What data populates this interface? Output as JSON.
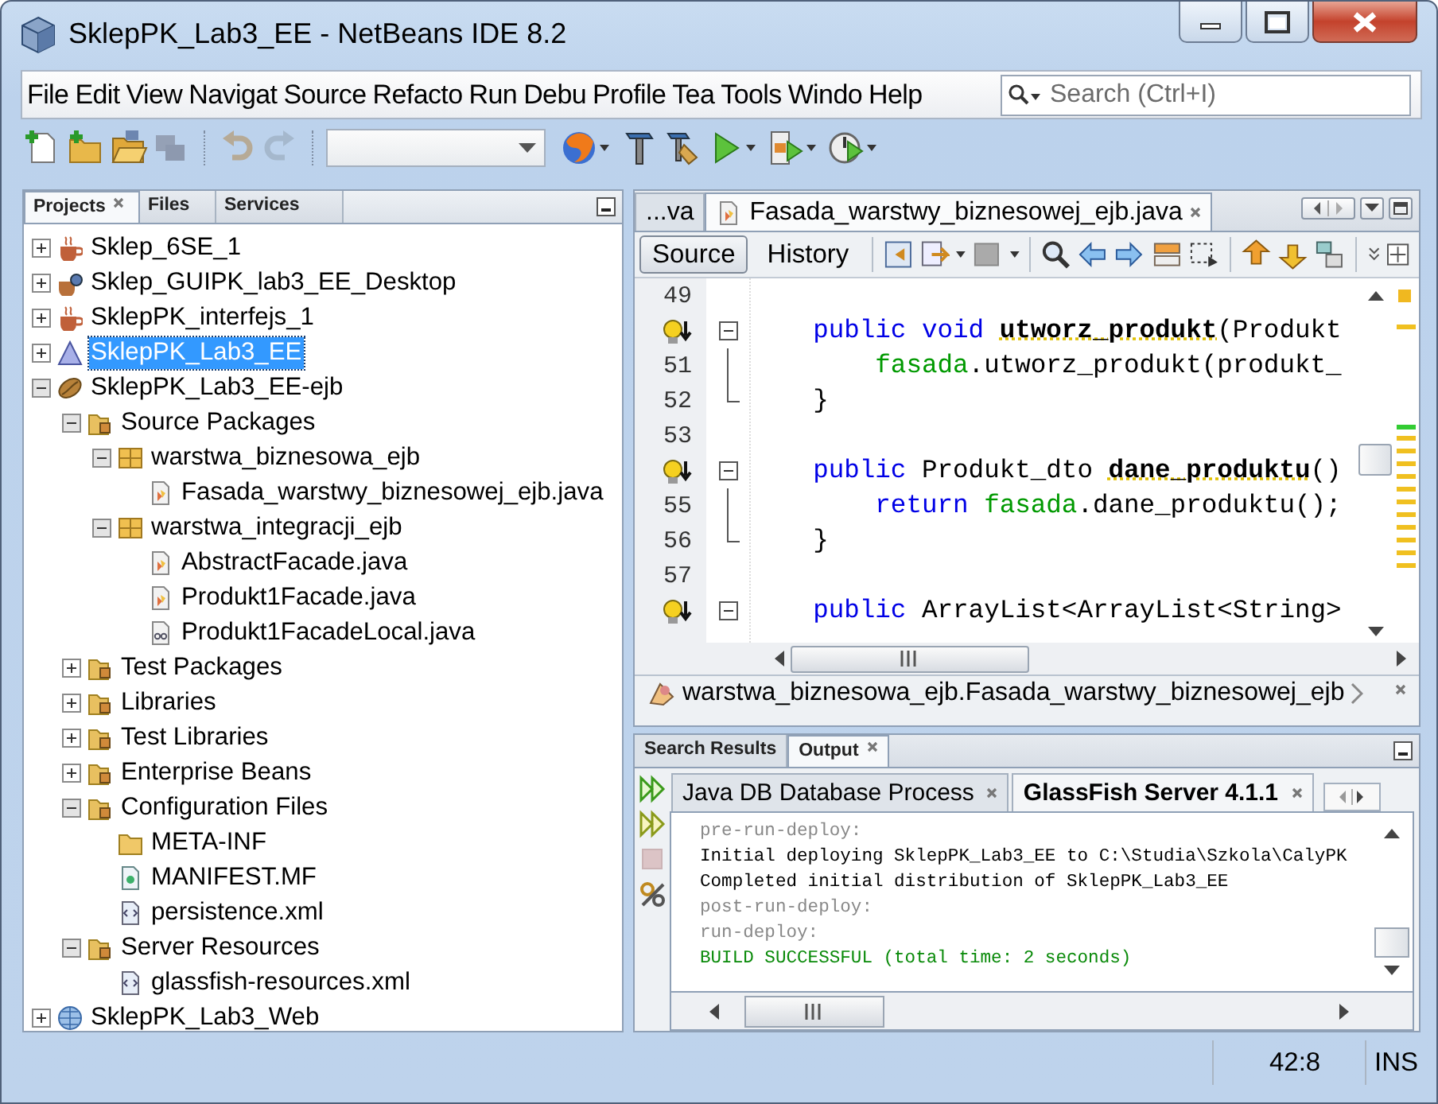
{
  "window": {
    "title": "SklepPK_Lab3_EE - NetBeans IDE 8.2"
  },
  "menu": [
    "File",
    "Edit",
    "View",
    "Navigat",
    "Source",
    "Refacto",
    "Run",
    "Debu",
    "Profile",
    "Tea",
    "Tools",
    "Windo",
    "Help"
  ],
  "search": {
    "placeholder": "Search (Ctrl+I)"
  },
  "toolbar": [
    {
      "kind": "new-file",
      "disabled": false
    },
    {
      "kind": "new-project",
      "disabled": false
    },
    {
      "kind": "open-project",
      "disabled": false
    },
    {
      "kind": "close-project",
      "disabled": true
    },
    {
      "kind": "separator"
    },
    {
      "kind": "undo",
      "disabled": true
    },
    {
      "kind": "redo",
      "disabled": true
    },
    {
      "kind": "separator"
    },
    {
      "kind": "combo"
    },
    {
      "kind": "browser",
      "disabled": false,
      "menu": true
    },
    {
      "kind": "build",
      "disabled": false
    },
    {
      "kind": "clean-build",
      "disabled": false
    },
    {
      "kind": "run",
      "disabled": false,
      "menu": true
    },
    {
      "kind": "debug",
      "disabled": false,
      "menu": true
    },
    {
      "kind": "profile",
      "disabled": false,
      "menu": true
    }
  ],
  "project_panel": {
    "tabs": [
      {
        "label": "Projects",
        "selected": true
      },
      {
        "label": "Files",
        "selected": false
      },
      {
        "label": "Services",
        "selected": false
      }
    ],
    "items": [
      {
        "label": "Sklep_6SE_1",
        "kind": "java-project",
        "expanded": false,
        "selected": false
      },
      {
        "label": "Sklep_GUIPK_lab3_EE_Desktop",
        "kind": "desktop-project",
        "expanded": false,
        "selected": false
      },
      {
        "label": "SklepPK_interfejs_1",
        "kind": "java-project",
        "expanded": false,
        "selected": false
      },
      {
        "label": "SklepPK_Lab3_EE",
        "kind": "enterprise-project",
        "expanded": false,
        "selected": true
      },
      {
        "label": "SklepPK_Lab3_EE-ejb",
        "kind": "ejb-module",
        "expanded": true,
        "selected": false,
        "children": [
          {
            "label": "Source Packages",
            "kind": "node-folder",
            "expanded": true,
            "selected": false,
            "children": [
              {
                "label": "warstwa_biznesowa_ejb",
                "kind": "package",
                "expanded": true,
                "selected": false,
                "children": [
                  {
                    "label": "Fasada_warstwy_biznesowej_ejb.java",
                    "kind": "java-file",
                    "selected": false
                  }
                ]
              },
              {
                "label": "warstwa_integracji_ejb",
                "kind": "package",
                "expanded": true,
                "selected": false,
                "children": [
                  {
                    "label": "AbstractFacade.java",
                    "kind": "java-file",
                    "selected": false
                  },
                  {
                    "label": "Produkt1Facade.java",
                    "kind": "java-file",
                    "selected": false
                  },
                  {
                    "label": "Produkt1FacadeLocal.java",
                    "kind": "java-interface",
                    "selected": false
                  }
                ]
              }
            ]
          },
          {
            "label": "Test Packages",
            "kind": "node-folder",
            "expanded": false,
            "selected": false
          },
          {
            "label": "Libraries",
            "kind": "node-folder",
            "expanded": false,
            "selected": false
          },
          {
            "label": "Test Libraries",
            "kind": "node-folder",
            "expanded": false,
            "selected": false
          },
          {
            "label": "Enterprise Beans",
            "kind": "node-folder",
            "expanded": false,
            "selected": false
          },
          {
            "label": "Configuration Files",
            "kind": "node-folder",
            "expanded": true,
            "selected": false,
            "children": [
              {
                "label": "META-INF",
                "kind": "folder",
                "selected": false
              },
              {
                "label": "MANIFEST.MF",
                "kind": "manifest",
                "selected": false
              },
              {
                "label": "persistence.xml",
                "kind": "xml-file",
                "selected": false
              }
            ]
          },
          {
            "label": "Server Resources",
            "kind": "node-folder",
            "expanded": true,
            "selected": false,
            "children": [
              {
                "label": "glassfish-resources.xml",
                "kind": "xml-file",
                "selected": false
              }
            ]
          }
        ]
      },
      {
        "label": "SklepPK_Lab3_Web",
        "kind": "web-project",
        "expanded": false,
        "selected": false
      }
    ]
  },
  "editor": {
    "tabs": [
      {
        "label": "...va",
        "selected": false
      },
      {
        "label": "Fasada_warstwy_biznesowej_ejb.java",
        "selected": true
      }
    ],
    "view_tabs": [
      {
        "label": "Source",
        "selected": true
      },
      {
        "label": "History",
        "selected": false
      }
    ],
    "lines": [
      {
        "number": "49"
      },
      {
        "hint": true,
        "kind": "fold-start",
        "tokens": [
          {
            "text": "    public void ",
            "kind": "keyword"
          },
          {
            "text": "utworz_produkt",
            "kind": "method"
          },
          {
            "text": "(Produkt",
            "kind": "plain"
          }
        ]
      },
      {
        "number": "51",
        "kind": "fold-body",
        "tokens": [
          {
            "text": "        fasada",
            "kind": "field"
          },
          {
            "text": ".utworz_produkt(produkt_",
            "kind": "plain"
          }
        ]
      },
      {
        "number": "52",
        "kind": "fold-end",
        "tokens": [
          {
            "text": "    }",
            "kind": "plain"
          }
        ]
      },
      {
        "number": "53"
      },
      {
        "hint": true,
        "kind": "fold-start",
        "tokens": [
          {
            "text": "    public",
            "kind": "keyword"
          },
          {
            "text": " Produkt_dto ",
            "kind": "plain"
          },
          {
            "text": "dane_produktu",
            "kind": "method"
          },
          {
            "text": "()",
            "kind": "plain"
          }
        ]
      },
      {
        "number": "55",
        "kind": "fold-body",
        "tokens": [
          {
            "text": "        return ",
            "kind": "keyword"
          },
          {
            "text": "fasada",
            "kind": "field"
          },
          {
            "text": ".dane_produktu();",
            "kind": "plain"
          }
        ]
      },
      {
        "number": "56",
        "kind": "fold-end",
        "tokens": [
          {
            "text": "    }",
            "kind": "plain"
          }
        ]
      },
      {
        "number": "57"
      },
      {
        "hint": true,
        "kind": "fold-start",
        "tokens": [
          {
            "text": "    public",
            "kind": "keyword"
          },
          {
            "text": " ArrayList<ArrayList<String>",
            "kind": "plain"
          }
        ]
      }
    ],
    "breadcrumb": "warstwa_biznesowa_ejb.Fasada_warstwy_biznesowej_ejb"
  },
  "output_panel": {
    "tabs": [
      {
        "label": "Search Results",
        "selected": false
      },
      {
        "label": "Output",
        "selected": true
      }
    ],
    "actions": [
      {
        "kind": "rerun",
        "disabled": false
      },
      {
        "kind": "rerun-changed",
        "disabled": false
      },
      {
        "kind": "stop",
        "disabled": true
      },
      {
        "kind": "settings",
        "disabled": false
      }
    ],
    "process_tabs": [
      {
        "label": "Java DB Database Process",
        "selected": false
      },
      {
        "label": "GlassFish Server 4.1.1",
        "selected": true
      }
    ],
    "lines": [
      {
        "text": "pre-run-deploy:",
        "kind": "target"
      },
      {
        "text": "Initial deploying SklepPK_Lab3_EE to C:\\Studia\\Szkola\\CalyPK",
        "kind": "info"
      },
      {
        "text": "Completed initial distribution of SklepPK_Lab3_EE",
        "kind": "info"
      },
      {
        "text": "post-run-deploy:",
        "kind": "target"
      },
      {
        "text": "run-deploy:",
        "kind": "target"
      },
      {
        "text": "BUILD SUCCESSFUL (total time: 2 seconds)",
        "kind": "success"
      }
    ]
  },
  "status_bar": {
    "position": "42:8",
    "mode": "INS"
  }
}
